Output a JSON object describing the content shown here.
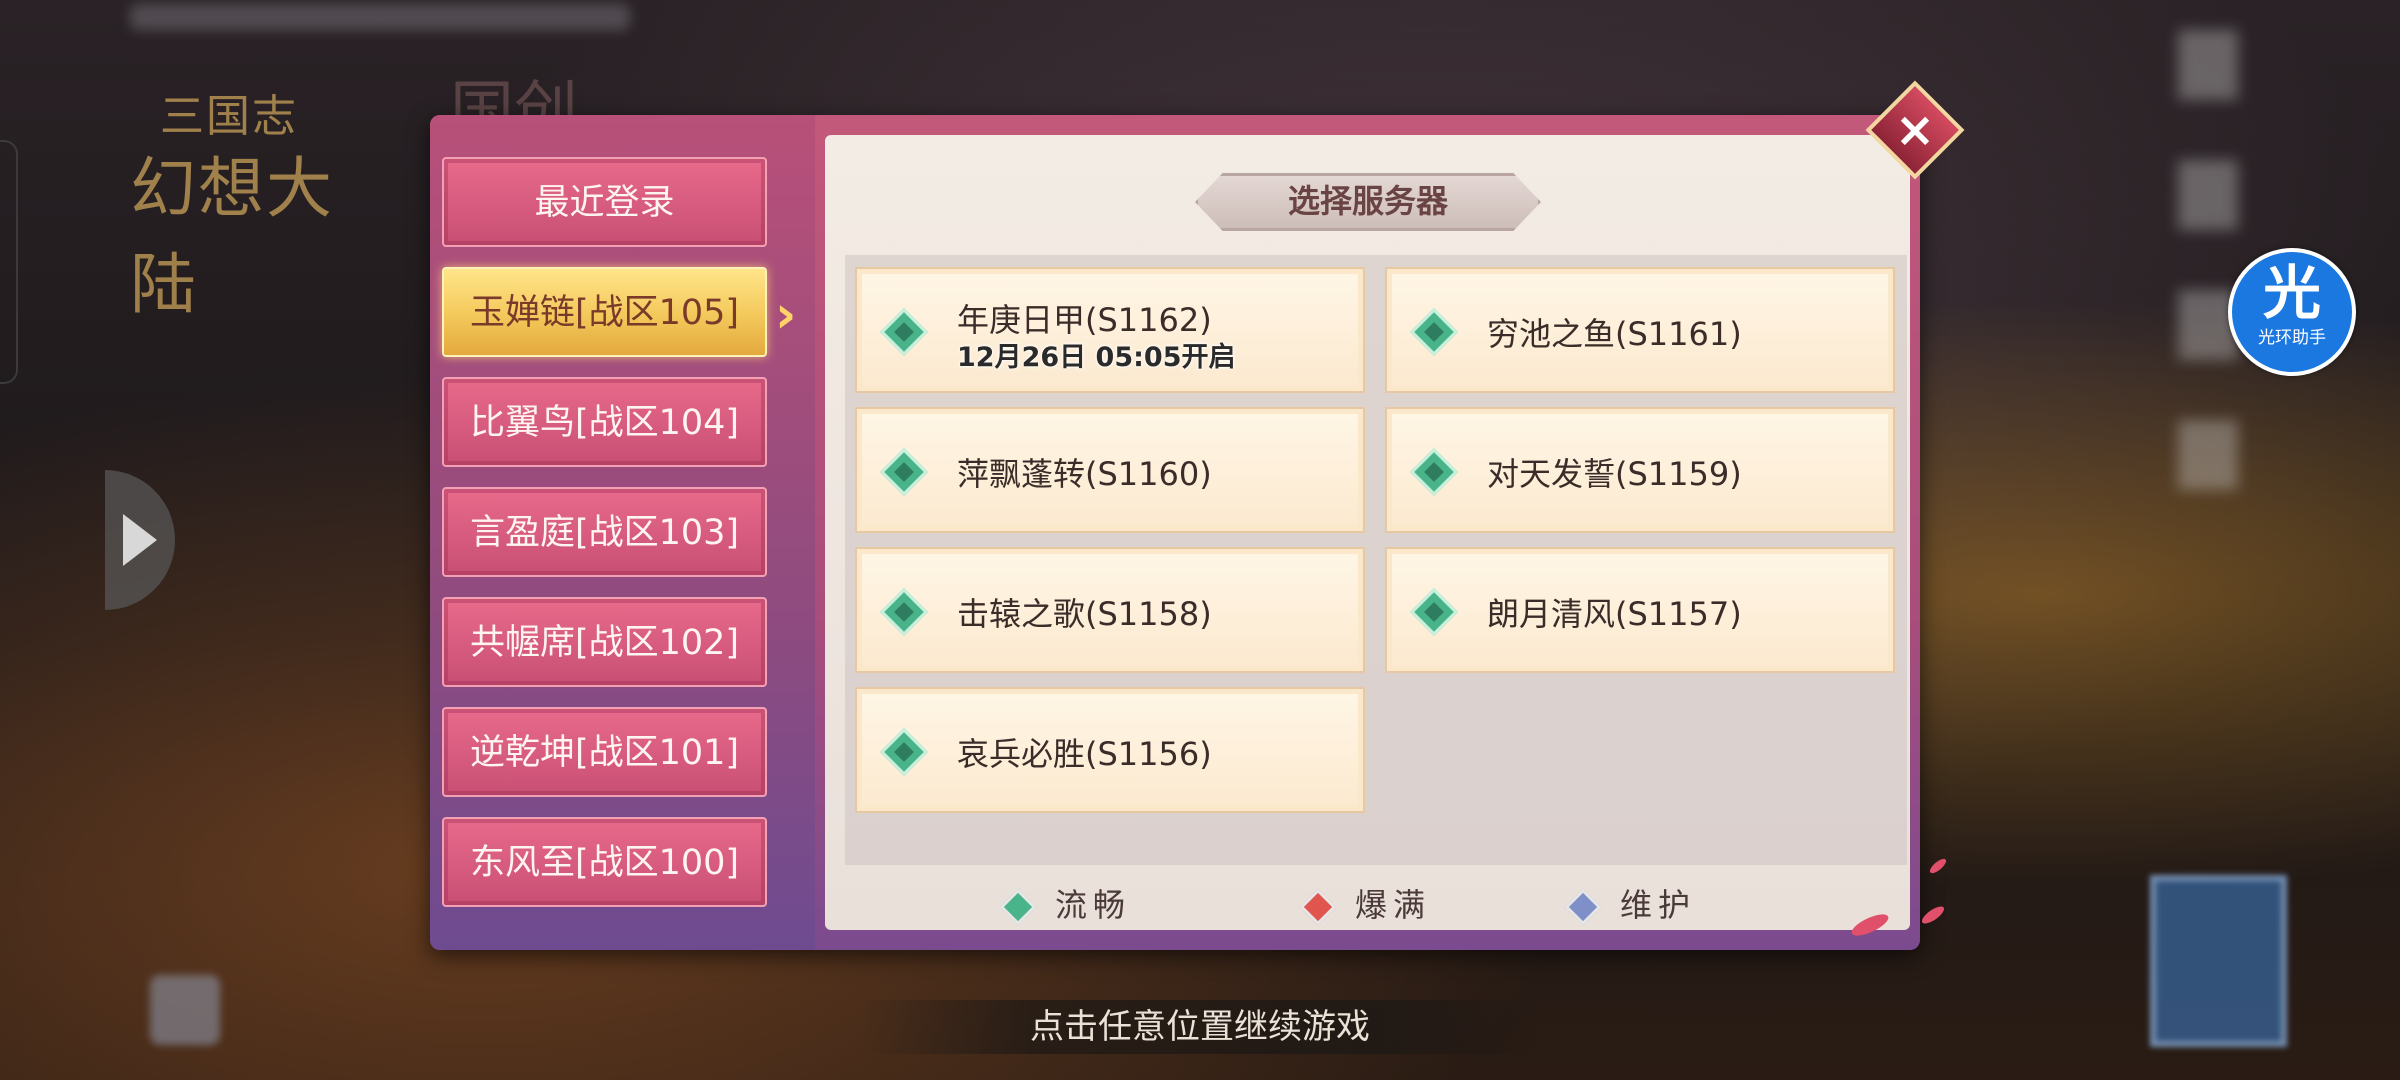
{
  "dialog": {
    "title": "选择服务器",
    "close_icon": "close-icon",
    "tabs": [
      {
        "label": "最近登录",
        "active": false
      },
      {
        "label": "玉婵链[战区105]",
        "active": true
      },
      {
        "label": "比翼鸟[战区104]",
        "active": false
      },
      {
        "label": "言盈庭[战区103]",
        "active": false
      },
      {
        "label": "共幄席[战区102]",
        "active": false
      },
      {
        "label": "逆乾坤[战区101]",
        "active": false
      },
      {
        "label": "东风至[战区100]",
        "active": false
      }
    ],
    "servers": [
      {
        "name": "年庚日甲(S1162)",
        "open_time": "12月26日 05:05开启",
        "status": "流畅"
      },
      {
        "name": "穷池之鱼(S1161)",
        "status": "流畅"
      },
      {
        "name": "萍飘蓬转(S1160)",
        "status": "流畅"
      },
      {
        "name": "对天发誓(S1159)",
        "status": "流畅"
      },
      {
        "name": "击辕之歌(S1158)",
        "status": "流畅"
      },
      {
        "name": "朗月清风(S1157)",
        "status": "流畅"
      },
      {
        "name": "哀兵必胜(S1156)",
        "status": "流畅"
      }
    ],
    "legend": [
      {
        "label": "流畅",
        "color": "#49b48a"
      },
      {
        "label": "爆满",
        "color": "#e0564f"
      },
      {
        "label": "维护",
        "color": "#7f8fc8"
      }
    ]
  },
  "overlay": {
    "continue_hint": "点击任意位置继续游戏",
    "assistant_glyph": "光",
    "assistant_label": "光环助手"
  },
  "game_logo": {
    "line1": "三国志",
    "line2": "幻想大陆"
  }
}
